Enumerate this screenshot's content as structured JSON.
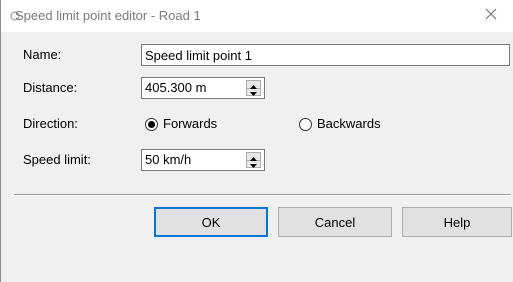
{
  "window": {
    "title": "Speed limit point editor - Road 1",
    "close_symbol": "×"
  },
  "form": {
    "name": {
      "label": "Name:",
      "value": "Speed limit point 1"
    },
    "distance": {
      "label": "Distance:",
      "value": "405.300 m"
    },
    "direction": {
      "label": "Direction:",
      "options": [
        {
          "label": "Forwards",
          "selected": true
        },
        {
          "label": "Backwards",
          "selected": false
        }
      ]
    },
    "speed_limit": {
      "label": "Speed limit:",
      "value": "50 km/h"
    }
  },
  "buttons": {
    "ok": "OK",
    "cancel": "Cancel",
    "help": "Help"
  },
  "colors": {
    "accent": "#0078d7",
    "background": "#f0f0f0"
  }
}
